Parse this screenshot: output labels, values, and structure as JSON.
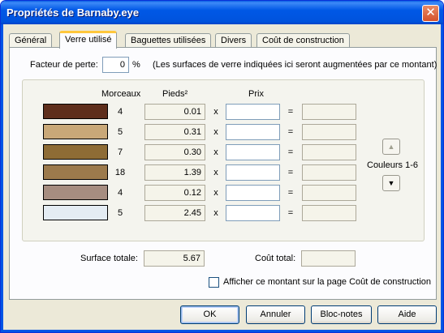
{
  "window": {
    "title": "Propriétés de Barnaby.eye",
    "close_glyph": "✕"
  },
  "tabs": [
    {
      "label": "Général"
    },
    {
      "label": "Verre utilisé"
    },
    {
      "label": "Baguettes utilisées"
    },
    {
      "label": "Divers"
    },
    {
      "label": "Coût de construction"
    }
  ],
  "waste": {
    "label": "Facteur de perte:",
    "value": "0",
    "unit": "%",
    "note": "(Les surfaces de verre indiquées ici seront augmentées par ce montant)"
  },
  "table": {
    "headers": {
      "pieces": "Morceaux",
      "area": "Pieds²",
      "price": "Prix"
    },
    "rows": [
      {
        "pieces": "4",
        "area": "0.01",
        "price": "",
        "total": "",
        "color": "#5e2e1c"
      },
      {
        "pieces": "5",
        "area": "0.31",
        "price": "",
        "total": "",
        "color": "#c9a878"
      },
      {
        "pieces": "7",
        "area": "0.30",
        "price": "",
        "total": "",
        "color": "#8e6c35"
      },
      {
        "pieces": "18",
        "area": "1.39",
        "price": "",
        "total": "",
        "color": "#9c7a4c"
      },
      {
        "pieces": "4",
        "area": "0.12",
        "price": "",
        "total": "",
        "color": "#a68d80"
      },
      {
        "pieces": "5",
        "area": "2.45",
        "price": "",
        "total": "",
        "color": "#e4ecf3"
      }
    ],
    "multiply_symbol": "x",
    "equals_symbol": "="
  },
  "colors_nav": {
    "label": "Couleurs 1-6",
    "up_icon": "arrow-up-icon",
    "down_icon": "arrow-down-icon"
  },
  "totals": {
    "surface_label": "Surface totale:",
    "surface_value": "5.67",
    "cost_label": "Coût total:",
    "cost_value": ""
  },
  "show_cost": {
    "label": "Afficher ce montant sur la page Coût de construction",
    "checked": false
  },
  "buttons": {
    "ok": "OK",
    "cancel": "Annuler",
    "notepad": "Bloc-notes",
    "help": "Aide"
  }
}
